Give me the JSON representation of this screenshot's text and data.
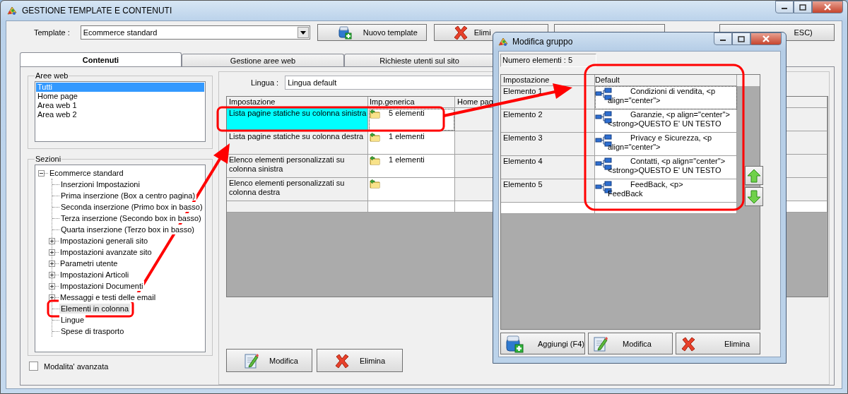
{
  "window": {
    "title": "GESTIONE TEMPLATE E CONTENUTI"
  },
  "template": {
    "label": "Template :",
    "value": "Ecommerce standard"
  },
  "toolbar": [
    {
      "label": "Nuovo template",
      "kind": "new"
    },
    {
      "label": "Elimi",
      "kind": "delete"
    },
    {
      "kind": "plain"
    },
    {
      "label": "ESC)",
      "kind": "exit"
    }
  ],
  "tabs": [
    {
      "label": "Contenuti",
      "selected": true
    },
    {
      "label": "Gestione aree web",
      "selected": false
    },
    {
      "label": "Richieste utenti sul sito",
      "selected": false
    }
  ],
  "aree_web": {
    "title": "Aree web",
    "items": [
      {
        "label": "Tutti",
        "selected": true
      },
      {
        "label": "Home page",
        "selected": false
      },
      {
        "label": "Area web 1",
        "selected": false
      },
      {
        "label": "Area web 2",
        "selected": false
      }
    ]
  },
  "sezioni": {
    "title": "Sezioni",
    "tree": [
      {
        "label": "Ecommerce standard",
        "kind": "group",
        "expanded": true,
        "selected": false,
        "children": [
          {
            "label": "Inserzioni Impostazioni",
            "kind": "leaf",
            "selected": false
          },
          {
            "label": "Prima inserzione (Box a centro pagina)",
            "kind": "leaf",
            "selected": false
          },
          {
            "label": "Seconda inserzione (Primo box in basso)",
            "kind": "leaf",
            "selected": false
          },
          {
            "label": "Terza inserzione (Secondo box in basso)",
            "kind": "leaf",
            "selected": false
          },
          {
            "label": "Quarta inserzione (Terzo box in basso)",
            "kind": "leaf",
            "selected": false
          },
          {
            "label": "Impostazioni generali sito",
            "kind": "group",
            "expanded": false,
            "selected": false
          },
          {
            "label": "Impostazioni avanzate sito",
            "kind": "group",
            "expanded": false,
            "selected": false
          },
          {
            "label": "Parametri utente",
            "kind": "group",
            "expanded": false,
            "selected": false
          },
          {
            "label": "Impostazioni Articoli",
            "kind": "group",
            "expanded": false,
            "selected": false
          },
          {
            "label": "Impostazioni Documenti",
            "kind": "group",
            "expanded": false,
            "selected": false
          },
          {
            "label": "Messaggi e testi delle email",
            "kind": "group",
            "expanded": false,
            "selected": false
          },
          {
            "label": "Elementi in colonna",
            "kind": "leaf",
            "selected": true
          },
          {
            "label": "Lingue",
            "kind": "leaf",
            "selected": false
          },
          {
            "label": "Spese di trasporto",
            "kind": "leaf",
            "selected": false
          }
        ]
      }
    ]
  },
  "advanced_mode": {
    "label": "Modalita' avanzata",
    "checked": false
  },
  "lingua": {
    "label": "Lingua :",
    "value": "Lingua default"
  },
  "settings_table": {
    "columns": [
      "Impostazione",
      "Imp.generica",
      "Home pag"
    ],
    "rows": [
      {
        "setting_lines": [
          "Lista pagine statiche su colonna sinistra"
        ],
        "value": "5 elementi",
        "selected": true
      },
      {
        "setting_lines": [
          "Lista pagine statiche su colonna destra"
        ],
        "value": "1 elementi",
        "selected": false
      },
      {
        "setting_lines": [
          "Elenco elementi personalizzati su",
          "colonna sinistra"
        ],
        "value": "1 elementi",
        "selected": false
      },
      {
        "setting_lines": [
          "Elenco elementi personalizzati su",
          "colonna destra"
        ],
        "selected": false
      }
    ]
  },
  "actions": [
    {
      "label": "Modifica",
      "kind": "edit"
    },
    {
      "label": "Elimina",
      "kind": "delete"
    }
  ],
  "dialog": {
    "title": "Modifica gruppo",
    "count": "Numero elementi : 5",
    "table": {
      "columns": [
        "Impostazione",
        "Default"
      ],
      "rows": [
        {
          "label": "Elemento 1",
          "value_lines": [
            "Condizioni di vendita, <p",
            "align=\"center\">"
          ],
          "selected": true
        },
        {
          "label": "Elemento 2",
          "value_lines": [
            "Garanzie, <p align=\"center\">",
            "<strong>QUESTO E' UN TESTO"
          ],
          "selected": false
        },
        {
          "label": "Elemento 3",
          "value_lines": [
            "Privacy e Sicurezza, <p",
            "align=\"center\">"
          ],
          "selected": false
        },
        {
          "label": "Elemento 4",
          "value_lines": [
            "Contatti, <p align=\"center\">",
            "<strong>QUESTO E' UN TESTO"
          ],
          "selected": false
        },
        {
          "label": "Elemento 5",
          "value_lines": [
            "FeedBack, <p>",
            "FeedBack"
          ],
          "selected": false
        }
      ]
    },
    "buttons": [
      {
        "label": "Aggiungi (F4)",
        "kind": "add"
      },
      {
        "label": "Modifica",
        "kind": "edit"
      },
      {
        "label": "Elimina",
        "kind": "delete"
      }
    ]
  }
}
